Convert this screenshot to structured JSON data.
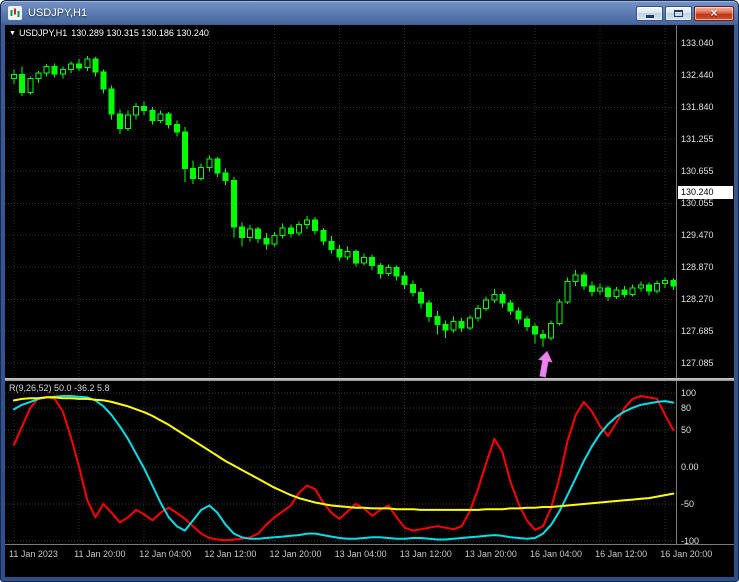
{
  "window": {
    "title": "USDJPY,H1",
    "close_glyph": "×"
  },
  "quote": {
    "symbol": "USDJPY,H1",
    "ohlc": "130.289 130.315 130.186 130.240"
  },
  "chart": {
    "colors": {
      "background": "#000000",
      "grid": "#2e2e2e",
      "candle": "#00ff00",
      "bull_fill": "#000000",
      "bear_fill": "#00ff00"
    },
    "price_axis": {
      "labels": [
        "133.040",
        "132.440",
        "131.840",
        "131.255",
        "130.655",
        "130.055",
        "129.470",
        "128.870",
        "128.270",
        "127.685",
        "127.085"
      ],
      "current_price": "130.240"
    },
    "time_axis": {
      "labels": [
        "11 Jan 2023",
        "11 Jan 20:00",
        "12 Jan 04:00",
        "12 Jan 12:00",
        "12 Jan 20:00",
        "13 Jan 04:00",
        "13 Jan 12:00",
        "13 Jan 20:00",
        "16 Jan 04:00",
        "16 Jan 12:00",
        "16 Jan 20:00"
      ]
    },
    "arrow": {
      "candle_index": 65,
      "color": "#ee82ee",
      "direction": "up"
    },
    "candles": [
      [
        132.38,
        132.55,
        132.28,
        132.45
      ],
      [
        132.45,
        132.6,
        132.05,
        132.12
      ],
      [
        132.12,
        132.42,
        132.08,
        132.38
      ],
      [
        132.38,
        132.52,
        132.3,
        132.48
      ],
      [
        132.48,
        132.65,
        132.42,
        132.6
      ],
      [
        132.6,
        132.66,
        132.4,
        132.46
      ],
      [
        132.46,
        132.6,
        132.38,
        132.55
      ],
      [
        132.55,
        132.7,
        132.48,
        132.65
      ],
      [
        132.65,
        132.74,
        132.52,
        132.58
      ],
      [
        132.58,
        132.8,
        132.52,
        132.74
      ],
      [
        132.74,
        132.78,
        132.42,
        132.5
      ],
      [
        132.5,
        132.55,
        132.1,
        132.18
      ],
      [
        132.18,
        132.25,
        131.62,
        131.72
      ],
      [
        131.72,
        131.8,
        131.35,
        131.45
      ],
      [
        131.45,
        131.78,
        131.4,
        131.7
      ],
      [
        131.7,
        131.92,
        131.62,
        131.86
      ],
      [
        131.86,
        131.95,
        131.7,
        131.78
      ],
      [
        131.78,
        131.85,
        131.52,
        131.6
      ],
      [
        131.6,
        131.78,
        131.55,
        131.72
      ],
      [
        131.72,
        131.76,
        131.45,
        131.52
      ],
      [
        131.52,
        131.6,
        131.3,
        131.38
      ],
      [
        131.38,
        131.48,
        130.45,
        130.7
      ],
      [
        130.7,
        130.85,
        130.42,
        130.52
      ],
      [
        130.52,
        130.8,
        130.48,
        130.72
      ],
      [
        130.72,
        130.95,
        130.65,
        130.88
      ],
      [
        130.88,
        130.92,
        130.55,
        130.62
      ],
      [
        130.62,
        130.7,
        130.4,
        130.48
      ],
      [
        130.48,
        130.55,
        129.42,
        129.62
      ],
      [
        129.62,
        129.7,
        129.25,
        129.42
      ],
      [
        129.42,
        129.65,
        129.35,
        129.58
      ],
      [
        129.58,
        129.62,
        129.32,
        129.4
      ],
      [
        129.4,
        129.5,
        129.2,
        129.3
      ],
      [
        129.3,
        129.52,
        129.25,
        129.46
      ],
      [
        129.46,
        129.68,
        129.4,
        129.6
      ],
      [
        129.6,
        129.66,
        129.42,
        129.5
      ],
      [
        129.5,
        129.72,
        129.45,
        129.66
      ],
      [
        129.66,
        129.82,
        129.58,
        129.75
      ],
      [
        129.75,
        129.8,
        129.48,
        129.55
      ],
      [
        129.55,
        129.6,
        129.28,
        129.35
      ],
      [
        129.35,
        129.45,
        129.12,
        129.2
      ],
      [
        129.2,
        129.28,
        128.98,
        129.06
      ],
      [
        129.06,
        129.25,
        129.0,
        129.16
      ],
      [
        129.16,
        129.2,
        128.88,
        128.95
      ],
      [
        128.95,
        129.12,
        128.9,
        129.05
      ],
      [
        129.05,
        129.1,
        128.82,
        128.9
      ],
      [
        128.9,
        128.95,
        128.66,
        128.75
      ],
      [
        128.75,
        128.92,
        128.7,
        128.86
      ],
      [
        128.86,
        128.9,
        128.62,
        128.7
      ],
      [
        128.7,
        128.78,
        128.46,
        128.55
      ],
      [
        128.55,
        128.62,
        128.32,
        128.4
      ],
      [
        128.4,
        128.48,
        128.1,
        128.2
      ],
      [
        128.2,
        128.26,
        127.85,
        127.95
      ],
      [
        127.95,
        128.05,
        127.62,
        127.8
      ],
      [
        127.8,
        127.88,
        127.55,
        127.7
      ],
      [
        127.7,
        127.95,
        127.65,
        127.86
      ],
      [
        127.86,
        127.92,
        127.66,
        127.74
      ],
      [
        127.74,
        127.98,
        127.7,
        127.92
      ],
      [
        127.92,
        128.16,
        127.86,
        128.1
      ],
      [
        128.1,
        128.32,
        128.05,
        128.26
      ],
      [
        128.26,
        128.46,
        128.2,
        128.36
      ],
      [
        128.36,
        128.42,
        128.12,
        128.2
      ],
      [
        128.2,
        128.26,
        127.98,
        128.05
      ],
      [
        128.05,
        128.12,
        127.82,
        127.9
      ],
      [
        127.9,
        127.96,
        127.68,
        127.76
      ],
      [
        127.76,
        127.82,
        127.45,
        127.62
      ],
      [
        127.62,
        127.7,
        127.38,
        127.55
      ],
      [
        127.55,
        127.88,
        127.5,
        127.82
      ],
      [
        127.82,
        128.28,
        127.78,
        128.22
      ],
      [
        128.22,
        128.68,
        128.18,
        128.6
      ],
      [
        128.6,
        128.82,
        128.52,
        128.72
      ],
      [
        128.72,
        128.78,
        128.44,
        128.52
      ],
      [
        128.52,
        128.6,
        128.32,
        128.42
      ],
      [
        128.42,
        128.56,
        128.36,
        128.48
      ],
      [
        128.48,
        128.52,
        128.24,
        128.32
      ],
      [
        128.32,
        128.5,
        128.28,
        128.44
      ],
      [
        128.44,
        128.52,
        128.3,
        128.36
      ],
      [
        128.36,
        128.55,
        128.32,
        128.48
      ],
      [
        128.48,
        128.6,
        128.42,
        128.54
      ],
      [
        128.54,
        128.58,
        128.34,
        128.42
      ],
      [
        128.42,
        128.62,
        128.38,
        128.56
      ],
      [
        128.56,
        128.68,
        128.48,
        128.62
      ],
      [
        128.62,
        128.66,
        128.44,
        128.52
      ]
    ]
  },
  "indicator": {
    "label": "R(9,26,52) 50.0 -36.2 5.8",
    "levels": [
      100,
      80,
      50,
      0,
      -50,
      -100
    ],
    "axis": [
      {
        "value": 100,
        "label": "100"
      },
      {
        "value": 80,
        "label": "80"
      },
      {
        "value": 50,
        "label": "50"
      },
      {
        "value": 0,
        "label": "0.00"
      },
      {
        "value": -50,
        "label": "-50"
      },
      {
        "value": -100,
        "label": "-100"
      }
    ],
    "series": [
      {
        "name": "red",
        "color": "#ff0000",
        "values": [
          30,
          55,
          80,
          93,
          95,
          92,
          75,
          40,
          0,
          -45,
          -68,
          -50,
          -62,
          -75,
          -68,
          -58,
          -64,
          -72,
          -62,
          -55,
          -62,
          -70,
          -80,
          -90,
          -96,
          -98,
          -99,
          -98,
          -97,
          -95,
          -90,
          -78,
          -68,
          -60,
          -52,
          -35,
          -25,
          -30,
          -48,
          -62,
          -70,
          -60,
          -50,
          -56,
          -66,
          -58,
          -52,
          -68,
          -82,
          -86,
          -84,
          -82,
          -80,
          -82,
          -84,
          -80,
          -60,
          -30,
          5,
          38,
          20,
          -20,
          -50,
          -72,
          -85,
          -80,
          -55,
          -15,
          35,
          70,
          88,
          75,
          55,
          42,
          60,
          80,
          92,
          96,
          94,
          92,
          70,
          50
        ]
      },
      {
        "name": "cyan",
        "color": "#00e0e8",
        "values": [
          78,
          84,
          88,
          92,
          94,
          95,
          96,
          96,
          95,
          94,
          90,
          82,
          70,
          55,
          38,
          18,
          -2,
          -25,
          -48,
          -68,
          -80,
          -86,
          -72,
          -58,
          -52,
          -62,
          -78,
          -90,
          -95,
          -97,
          -97,
          -96,
          -95,
          -94,
          -93,
          -92,
          -90,
          -90,
          -92,
          -94,
          -96,
          -97,
          -97,
          -96,
          -95,
          -95,
          -96,
          -97,
          -97,
          -96,
          -96,
          -97,
          -98,
          -98,
          -97,
          -96,
          -95,
          -94,
          -93,
          -92,
          -93,
          -95,
          -96,
          -97,
          -96,
          -90,
          -78,
          -60,
          -38,
          -15,
          8,
          28,
          45,
          58,
          68,
          75,
          80,
          84,
          86,
          88,
          89,
          87
        ]
      },
      {
        "name": "yellow",
        "color": "#ffff00",
        "values": [
          90,
          92,
          93,
          93,
          94,
          94,
          93,
          93,
          92,
          92,
          91,
          90,
          88,
          85,
          82,
          78,
          74,
          69,
          63,
          57,
          50,
          43,
          36,
          29,
          22,
          15,
          8,
          2,
          -4,
          -10,
          -16,
          -22,
          -28,
          -33,
          -38,
          -42,
          -45,
          -48,
          -50,
          -52,
          -53,
          -54,
          -55,
          -55,
          -56,
          -56,
          -56,
          -57,
          -57,
          -57,
          -58,
          -58,
          -58,
          -58,
          -58,
          -58,
          -58,
          -58,
          -57,
          -57,
          -57,
          -56,
          -56,
          -55,
          -55,
          -54,
          -54,
          -53,
          -52,
          -51,
          -50,
          -49,
          -48,
          -47,
          -46,
          -45,
          -44,
          -43,
          -42,
          -40,
          -38,
          -36
        ]
      }
    ]
  }
}
